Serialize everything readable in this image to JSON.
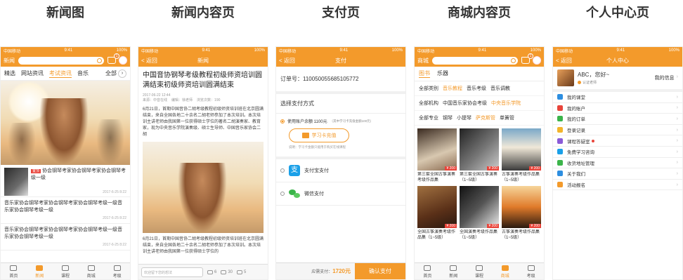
{
  "headers": [
    "新闻图",
    "新闻内容页",
    "支付页",
    "商城内容页",
    "个人中心页"
  ],
  "status": {
    "carrier": "中国移动",
    "time": "9:41",
    "battery": "100%"
  },
  "colors": {
    "accent": "#f39a2b",
    "tag_red": "#e8443a",
    "alipay_blue": "#1aa0e8",
    "wechat_green": "#3bb44a"
  },
  "tabbar": [
    {
      "label": "首页",
      "icon": "home-icon"
    },
    {
      "label": "新闻",
      "icon": "news-icon"
    },
    {
      "label": "课程",
      "icon": "course-icon"
    },
    {
      "label": "商城",
      "icon": "shop-icon"
    },
    {
      "label": "考级",
      "icon": "exam-icon"
    }
  ],
  "screen1": {
    "nav_left": "新闻",
    "cart_badge": "1",
    "tabs": [
      "精选",
      "网站资讯",
      "考试资讯",
      "音乐"
    ],
    "active_tab": "考试资讯",
    "more_label": "全部",
    "news": [
      {
        "tag": "置顶",
        "title": "协会钢琴考家协会钢琴考家协会钢琴考级一级",
        "date": "2017-6-25 8:22"
      },
      {
        "title": "音乐家协会钢琴考家协会钢琴考家协会钢琴考级一级音乐家协会钢琴考级一级",
        "date": "2017-6-25 8:22"
      },
      {
        "title": "音乐家协会钢琴考家协会钢琴考家协会钢琴考级一级音乐家协会钢琴考级一级",
        "date": "2017-6-25 8:22"
      }
    ]
  },
  "screen2": {
    "back": "< 返回",
    "title": "新闻",
    "article_title": "中国音协钢琴考级教程初级师资培训圆满结束初级师资培训圆满结束",
    "meta": {
      "date": "2017-06-22 12:44",
      "source": "来源：中音在线",
      "editor": "编辑：徐老师",
      "views": "浏览次数：190"
    },
    "para1": "6月21日，首期中国音协二胡考级教程初级师资培训班在北京圆满结束，来自全国各地二十余名二胡老师参加了本次培训。本次培训主讲老师由我国第一位获得硕士学位的著名二胡演奏家、教育家，现为中央音乐学院演奏级、硕士生导师、中国音乐家协会二胡",
    "para2": "6月21日，首期中国音协二胡考级教程初级师资培训班在北京圆满结束，来自全国各地二十余名二胡老师参加了本次培训。本次培训主讲老师由我国第一位获得硕士学位的",
    "comment_placeholder": "欢迎留下您的想法",
    "comments": "6",
    "shares": "30",
    "likes": "5"
  },
  "screen3": {
    "back": "< 返回",
    "title": "支付",
    "order_no": "订单号：110050055685105772",
    "choose": "选择支付方式",
    "balance_label": "使用账户余额 1100元",
    "balance_note": "（其中学习卡充值金额100元）",
    "recharge": "学习卡充值",
    "note": "说明：学习卡金额只能用于购买在线课程",
    "alipay": "支付宝支付",
    "wechat": "微信支付",
    "total_label": "应需支付：",
    "total_value": "1720元",
    "confirm": "确认支付"
  },
  "screen4": {
    "nav_left": "商城",
    "cart_badge": "1",
    "tabs": [
      "图书",
      "乐器"
    ],
    "filters": [
      [
        "全部类别",
        "音乐教程",
        "音乐考级",
        "音乐调教"
      ],
      [
        "全部机构",
        "中国音乐家协会考级",
        "中央音乐学院"
      ],
      [
        "全部专业",
        "钢琴",
        "小提琴",
        "萨克斯管",
        "单簧管"
      ]
    ],
    "active_filters": [
      "音乐教程",
      "中央音乐学院",
      "萨克斯管"
    ],
    "products": [
      {
        "name": "第三套全国古筝演奏考级作品集",
        "price": "¥ 200"
      },
      {
        "name": "第三套全国古筝演奏（1~5级）",
        "price": "¥ 200"
      },
      {
        "name": "古筝演奏考级作品集（1~5级）",
        "price": "¥ 200"
      },
      {
        "name": "全国古筝演奏考级作品集（1~5级）",
        "price": "¥ 200"
      },
      {
        "name": "全国演奏考级作品集（1~5级）",
        "price": "¥ 200"
      },
      {
        "name": "古筝演奏考级作品集（1~5级）",
        "price": "¥ 200"
      }
    ]
  },
  "screen5": {
    "back": "< 返回",
    "title": "个人中心",
    "greeting": "ABC，您好~",
    "cert": "认证老师",
    "my_info": "我的信息",
    "menu": [
      {
        "label": "我的课堂",
        "icon": "classroom-icon",
        "color": "#2d8ee0"
      },
      {
        "label": "我的账户",
        "icon": "account-icon",
        "color": "#e8443a"
      },
      {
        "label": "我的订单",
        "icon": "order-icon",
        "color": "#3bb44a"
      },
      {
        "label": "登录记录",
        "icon": "login-record-icon",
        "color": "#f3b42b"
      },
      {
        "label": "课程答疑室",
        "icon": "qa-icon",
        "color": "#8a5ad8",
        "dot": true
      },
      {
        "label": "免费学习咨询",
        "icon": "consult-icon",
        "color": "#1aa0e8"
      },
      {
        "label": "收货地址管理",
        "icon": "address-icon",
        "color": "#3bb44a"
      },
      {
        "label": "关于我们",
        "icon": "about-icon",
        "color": "#2d8ee0"
      },
      {
        "label": "活动报名",
        "icon": "signup-icon",
        "color": "#f39a2b"
      }
    ]
  }
}
